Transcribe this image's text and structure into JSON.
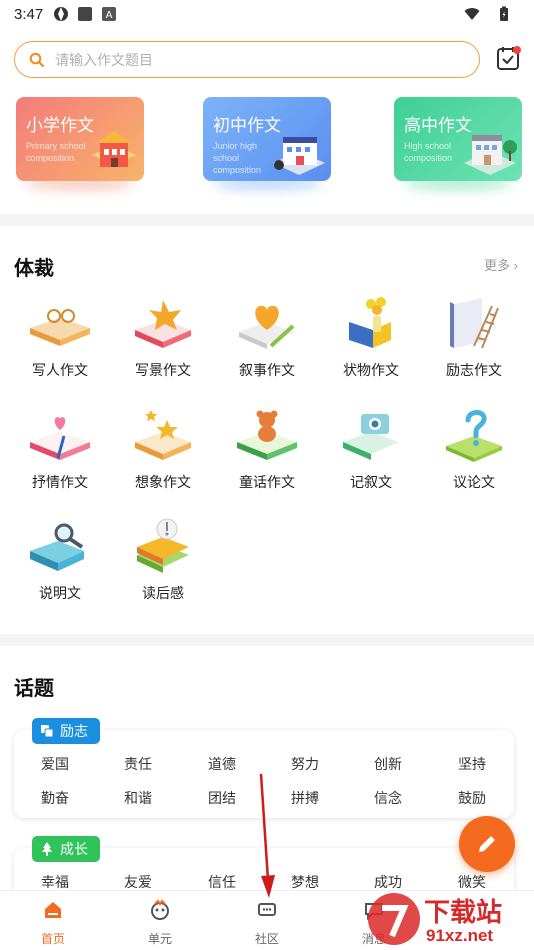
{
  "status_bar": {
    "time": "3:47"
  },
  "search": {
    "placeholder": "请输入作文题目"
  },
  "levels": [
    {
      "title": "小学作文",
      "subtitle": "Primary school composition",
      "color": "#f28a73"
    },
    {
      "title": "初中作文",
      "subtitle": "Junior high school composition",
      "color": "#6fa8f5"
    },
    {
      "title": "高中作文",
      "subtitle": "High school composition",
      "color": "#4fd2a0"
    }
  ],
  "genre": {
    "title": "体裁",
    "more": "更多",
    "items": [
      {
        "label": "写人作文",
        "icon": "glasses-book-icon"
      },
      {
        "label": "写景作文",
        "icon": "leaf-book-icon"
      },
      {
        "label": "叙事作文",
        "icon": "heart-pencil-icon"
      },
      {
        "label": "状物作文",
        "icon": "flower-vase-icon"
      },
      {
        "label": "励志作文",
        "icon": "ladder-book-icon"
      },
      {
        "label": "抒情作文",
        "icon": "heart-book-icon"
      },
      {
        "label": "想象作文",
        "icon": "star-book-icon"
      },
      {
        "label": "童话作文",
        "icon": "teddy-bear-book-icon"
      },
      {
        "label": "记叙文",
        "icon": "camera-book-icon"
      },
      {
        "label": "议论文",
        "icon": "question-book-icon"
      },
      {
        "label": "说明文",
        "icon": "magnifier-book-icon"
      },
      {
        "label": "读后感",
        "icon": "comment-book-icon"
      }
    ]
  },
  "topics": {
    "title": "话题",
    "groups": [
      {
        "badge": "励志",
        "color": "#1a8fe0",
        "words": [
          "爱国",
          "责任",
          "道德",
          "努力",
          "创新",
          "坚持",
          "勤奋",
          "和谐",
          "团结",
          "拼搏",
          "信念",
          "鼓励"
        ]
      },
      {
        "badge": "成长",
        "color": "#2fc35a",
        "words": [
          "幸福",
          "友爱",
          "信任",
          "梦想",
          "成功",
          "微笑"
        ]
      }
    ]
  },
  "nav": {
    "items": [
      {
        "label": "首页",
        "icon": "home-icon",
        "active": true
      },
      {
        "label": "单元",
        "icon": "unit-icon",
        "active": false
      },
      {
        "label": "社区",
        "icon": "community-icon",
        "active": false
      },
      {
        "label": "消息",
        "icon": "message-icon",
        "active": false
      }
    ]
  },
  "watermark": {
    "text": "下载站",
    "url_text": "91xz.net"
  }
}
